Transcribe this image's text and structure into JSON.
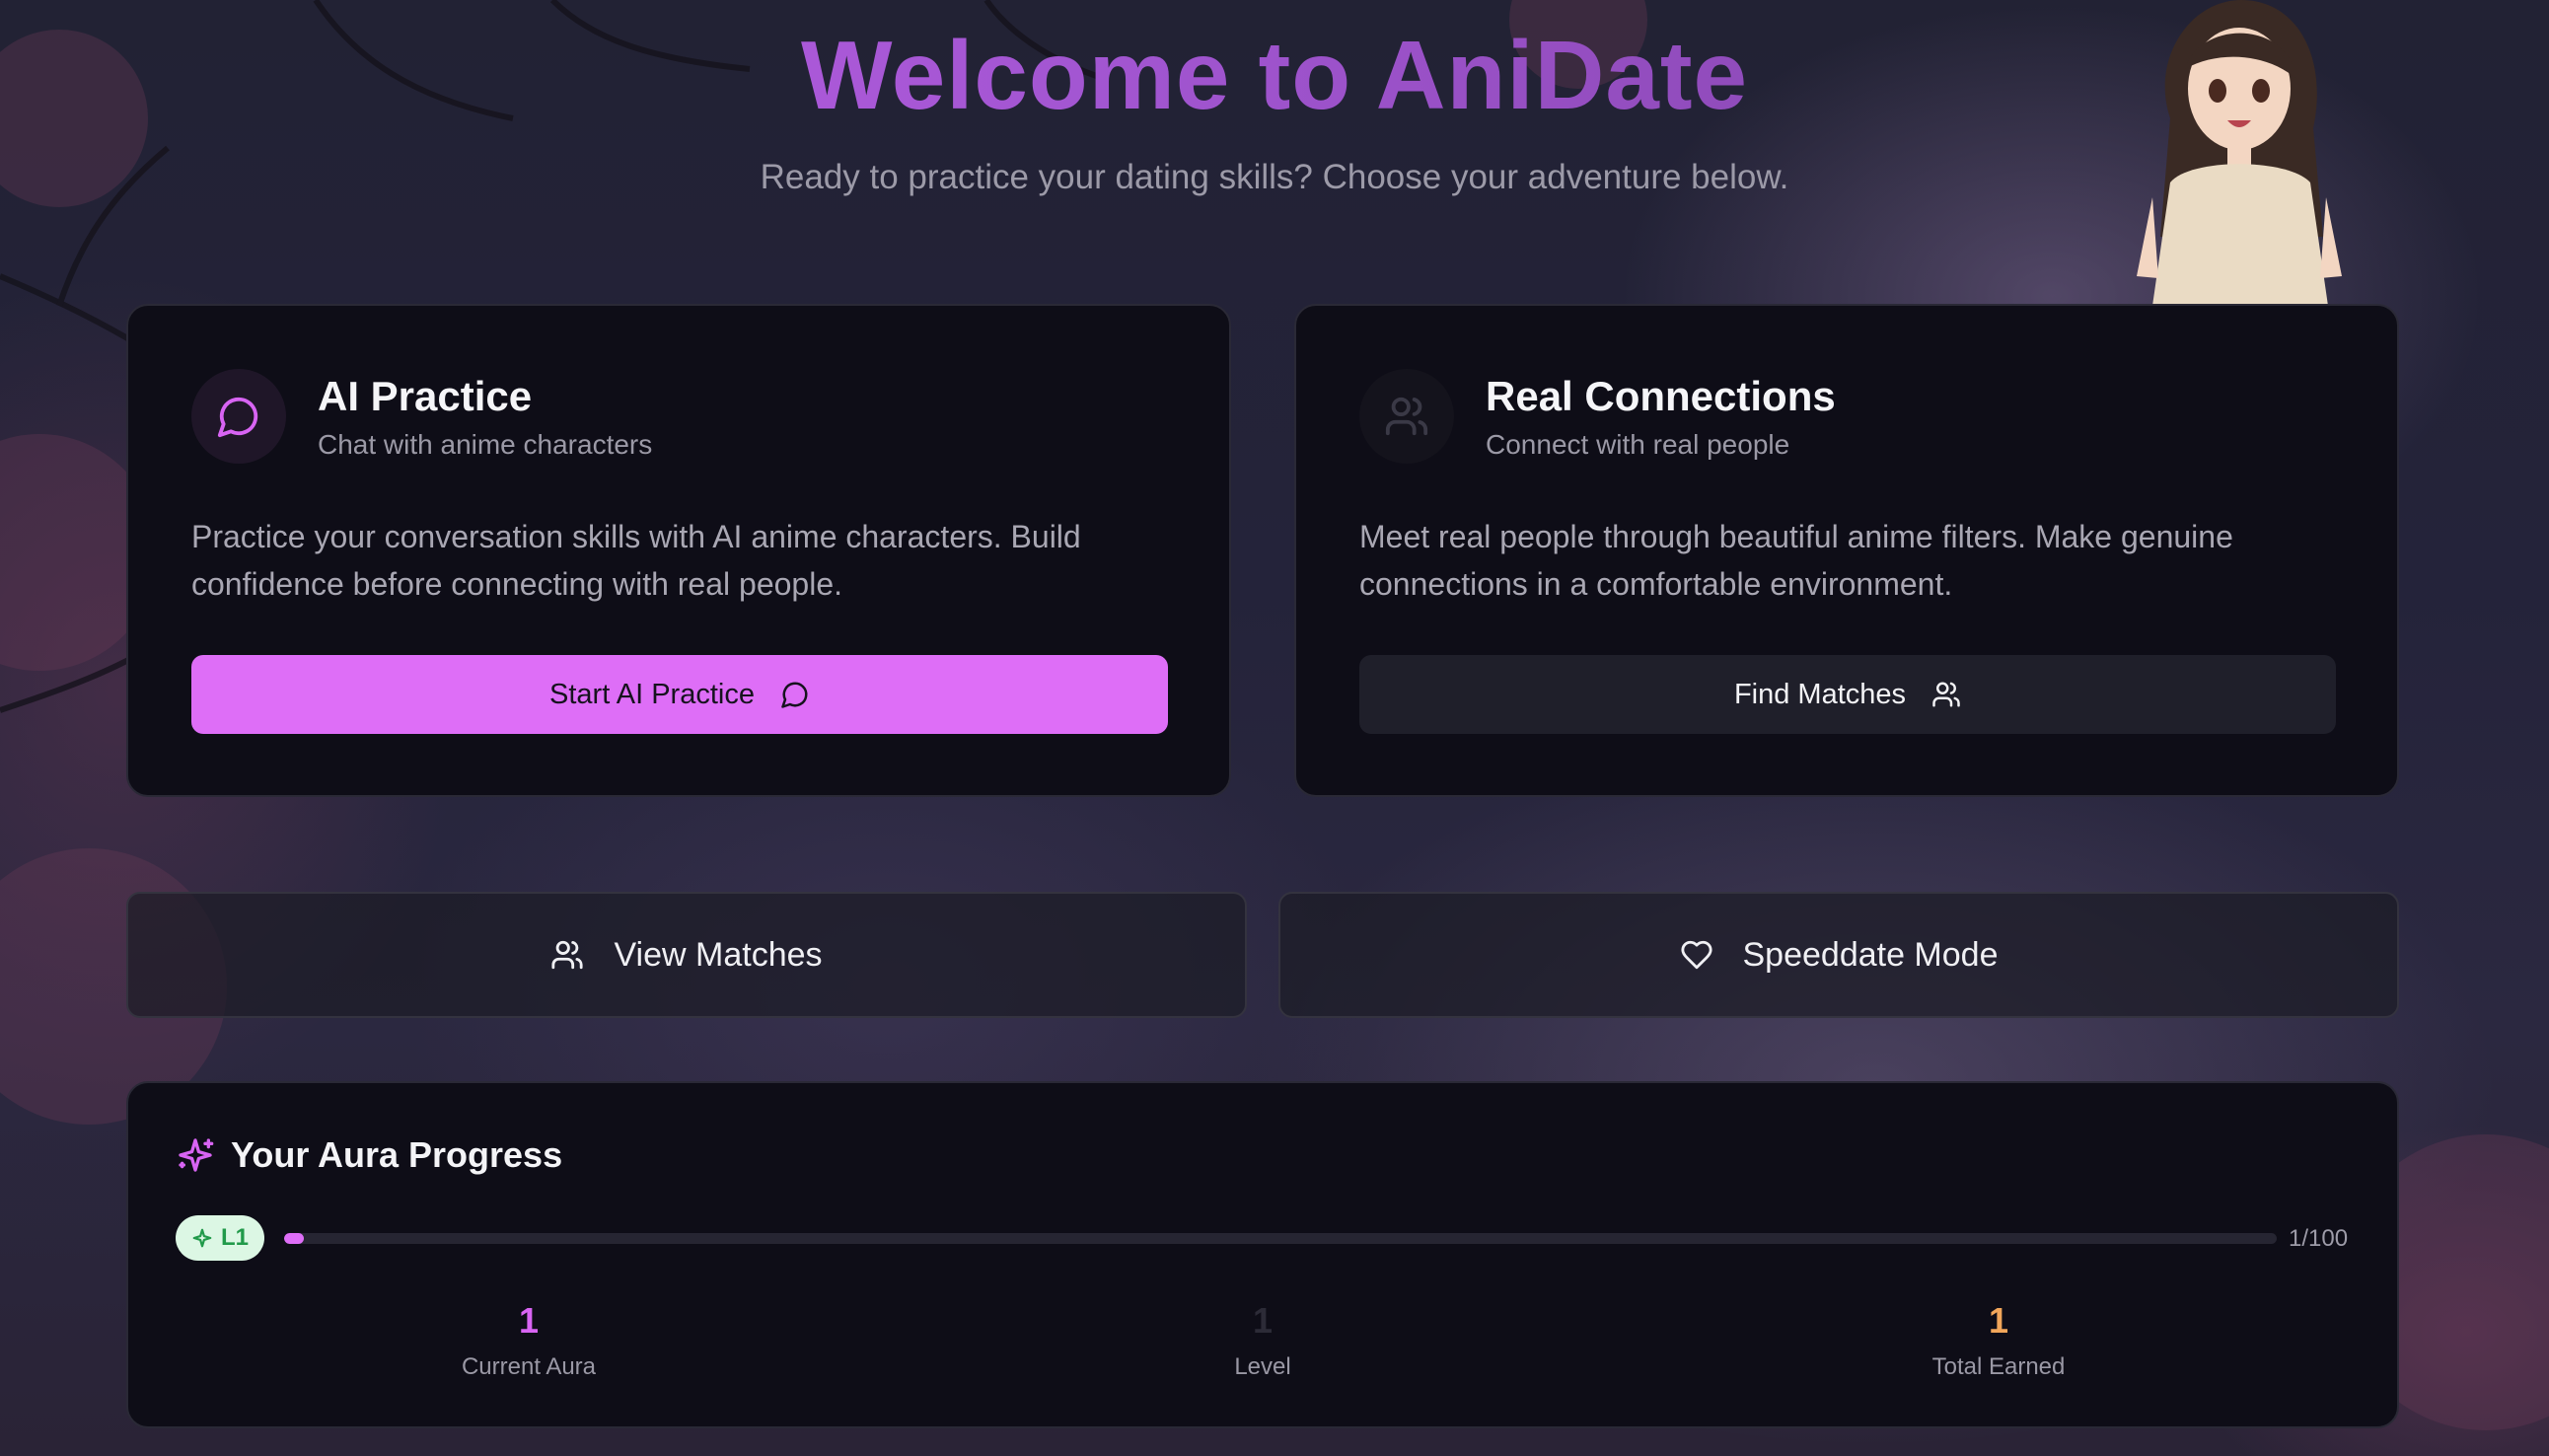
{
  "header": {
    "title": "Welcome to AniDate",
    "subtitle": "Ready to practice your dating skills? Choose your adventure below."
  },
  "cards": [
    {
      "title": "AI Practice",
      "subtitle": "Chat with anime characters",
      "description": "Practice your conversation skills with AI anime characters. Build confidence before connecting with real people.",
      "button_label": "Start AI Practice",
      "icon": "chat-bubble-icon"
    },
    {
      "title": "Real Connections",
      "subtitle": "Connect with real people",
      "description": "Meet real people through beautiful anime filters. Make genuine connections in a comfortable environment.",
      "button_label": "Find Matches",
      "icon": "users-icon"
    }
  ],
  "actions": {
    "view_matches": "View Matches",
    "speeddate": "Speeddate Mode"
  },
  "aura": {
    "title": "Your Aura Progress",
    "level_badge": "L1",
    "progress_text": "1/100",
    "progress_fraction": 0.01,
    "stats": [
      {
        "value": "1",
        "label": "Current Aura"
      },
      {
        "value": "1",
        "label": "Level"
      },
      {
        "value": "1",
        "label": "Total Earned"
      }
    ]
  },
  "colors": {
    "accent": "#de6ef7",
    "badge_green": "#219a4a",
    "earned_orange": "#f2a65a"
  }
}
